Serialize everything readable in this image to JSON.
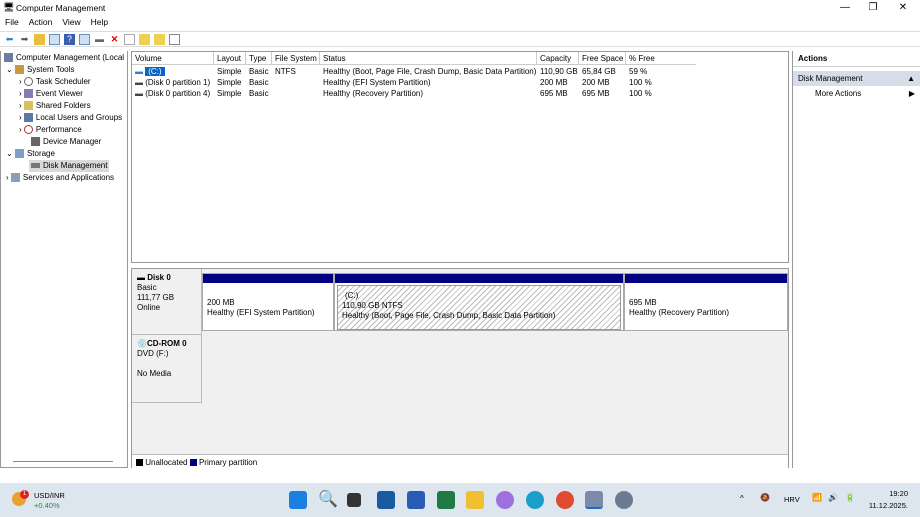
{
  "window": {
    "title": "Computer Management",
    "minimize": "—",
    "maximize": "❐",
    "close": "✕"
  },
  "menu": [
    "File",
    "Action",
    "View",
    "Help"
  ],
  "tree": [
    {
      "label": "Computer Management (Local",
      "icon": "computer-management-icon"
    },
    {
      "label": "System Tools",
      "icon": "tools-icon"
    },
    {
      "label": "Task Scheduler",
      "icon": "clock-icon"
    },
    {
      "label": "Event Viewer",
      "icon": "event-viewer-icon"
    },
    {
      "label": "Shared Folders",
      "icon": "shared-folder-icon"
    },
    {
      "label": "Local Users and Groups",
      "icon": "users-icon"
    },
    {
      "label": "Performance",
      "icon": "performance-icon"
    },
    {
      "label": "Device Manager",
      "icon": "device-manager-icon"
    },
    {
      "label": "Storage",
      "icon": "storage-icon"
    },
    {
      "label": "Disk Management",
      "icon": "disk-management-icon"
    },
    {
      "label": "Services and Applications",
      "icon": "services-icon"
    }
  ],
  "volumes": {
    "headers": [
      "Volume",
      "Layout",
      "Type",
      "File System",
      "Status",
      "Capacity",
      "Free Space",
      "% Free"
    ],
    "rows": [
      [
        "(C:)",
        "Simple",
        "Basic",
        "NTFS",
        "Healthy (Boot, Page File, Crash Dump, Basic Data Partition)",
        "110,90 GB",
        "65,84 GB",
        "59 %"
      ],
      [
        "(Disk 0 partition 1)",
        "Simple",
        "Basic",
        "",
        "Healthy (EFI System Partition)",
        "200 MB",
        "200 MB",
        "100 %"
      ],
      [
        "(Disk 0 partition 4)",
        "Simple",
        "Basic",
        "",
        "Healthy (Recovery Partition)",
        "695 MB",
        "695 MB",
        "100 %"
      ]
    ]
  },
  "disks": {
    "disk0": {
      "name": "Disk 0",
      "type": "Basic",
      "size": "111,77 GB",
      "status": "Online",
      "partitions": [
        {
          "label": "",
          "size": "200 MB",
          "status": "Healthy (EFI System Partition)"
        },
        {
          "label": "(C:)",
          "size": "110,90 GB NTFS",
          "status": "Healthy (Boot, Page File, Crash Dump, Basic Data Partition)"
        },
        {
          "label": "",
          "size": "695 MB",
          "status": "Healthy (Recovery Partition)"
        }
      ]
    },
    "cdrom": {
      "name": "CD-ROM 0",
      "type": "DVD (F:)",
      "status": "No Media"
    }
  },
  "legend": {
    "unallocated": "Unallocated",
    "primary": "Primary partition",
    "unallocated_color": "#000000",
    "primary_color": "#000080"
  },
  "actions": {
    "title": "Actions",
    "section": "Disk Management",
    "more": "More Actions"
  },
  "taskbar": {
    "widget_title": "USD/INR",
    "widget_value": "+0.40%",
    "badge": "1",
    "lang": "HRV",
    "time": "19:20",
    "date": "11.12.2025."
  }
}
